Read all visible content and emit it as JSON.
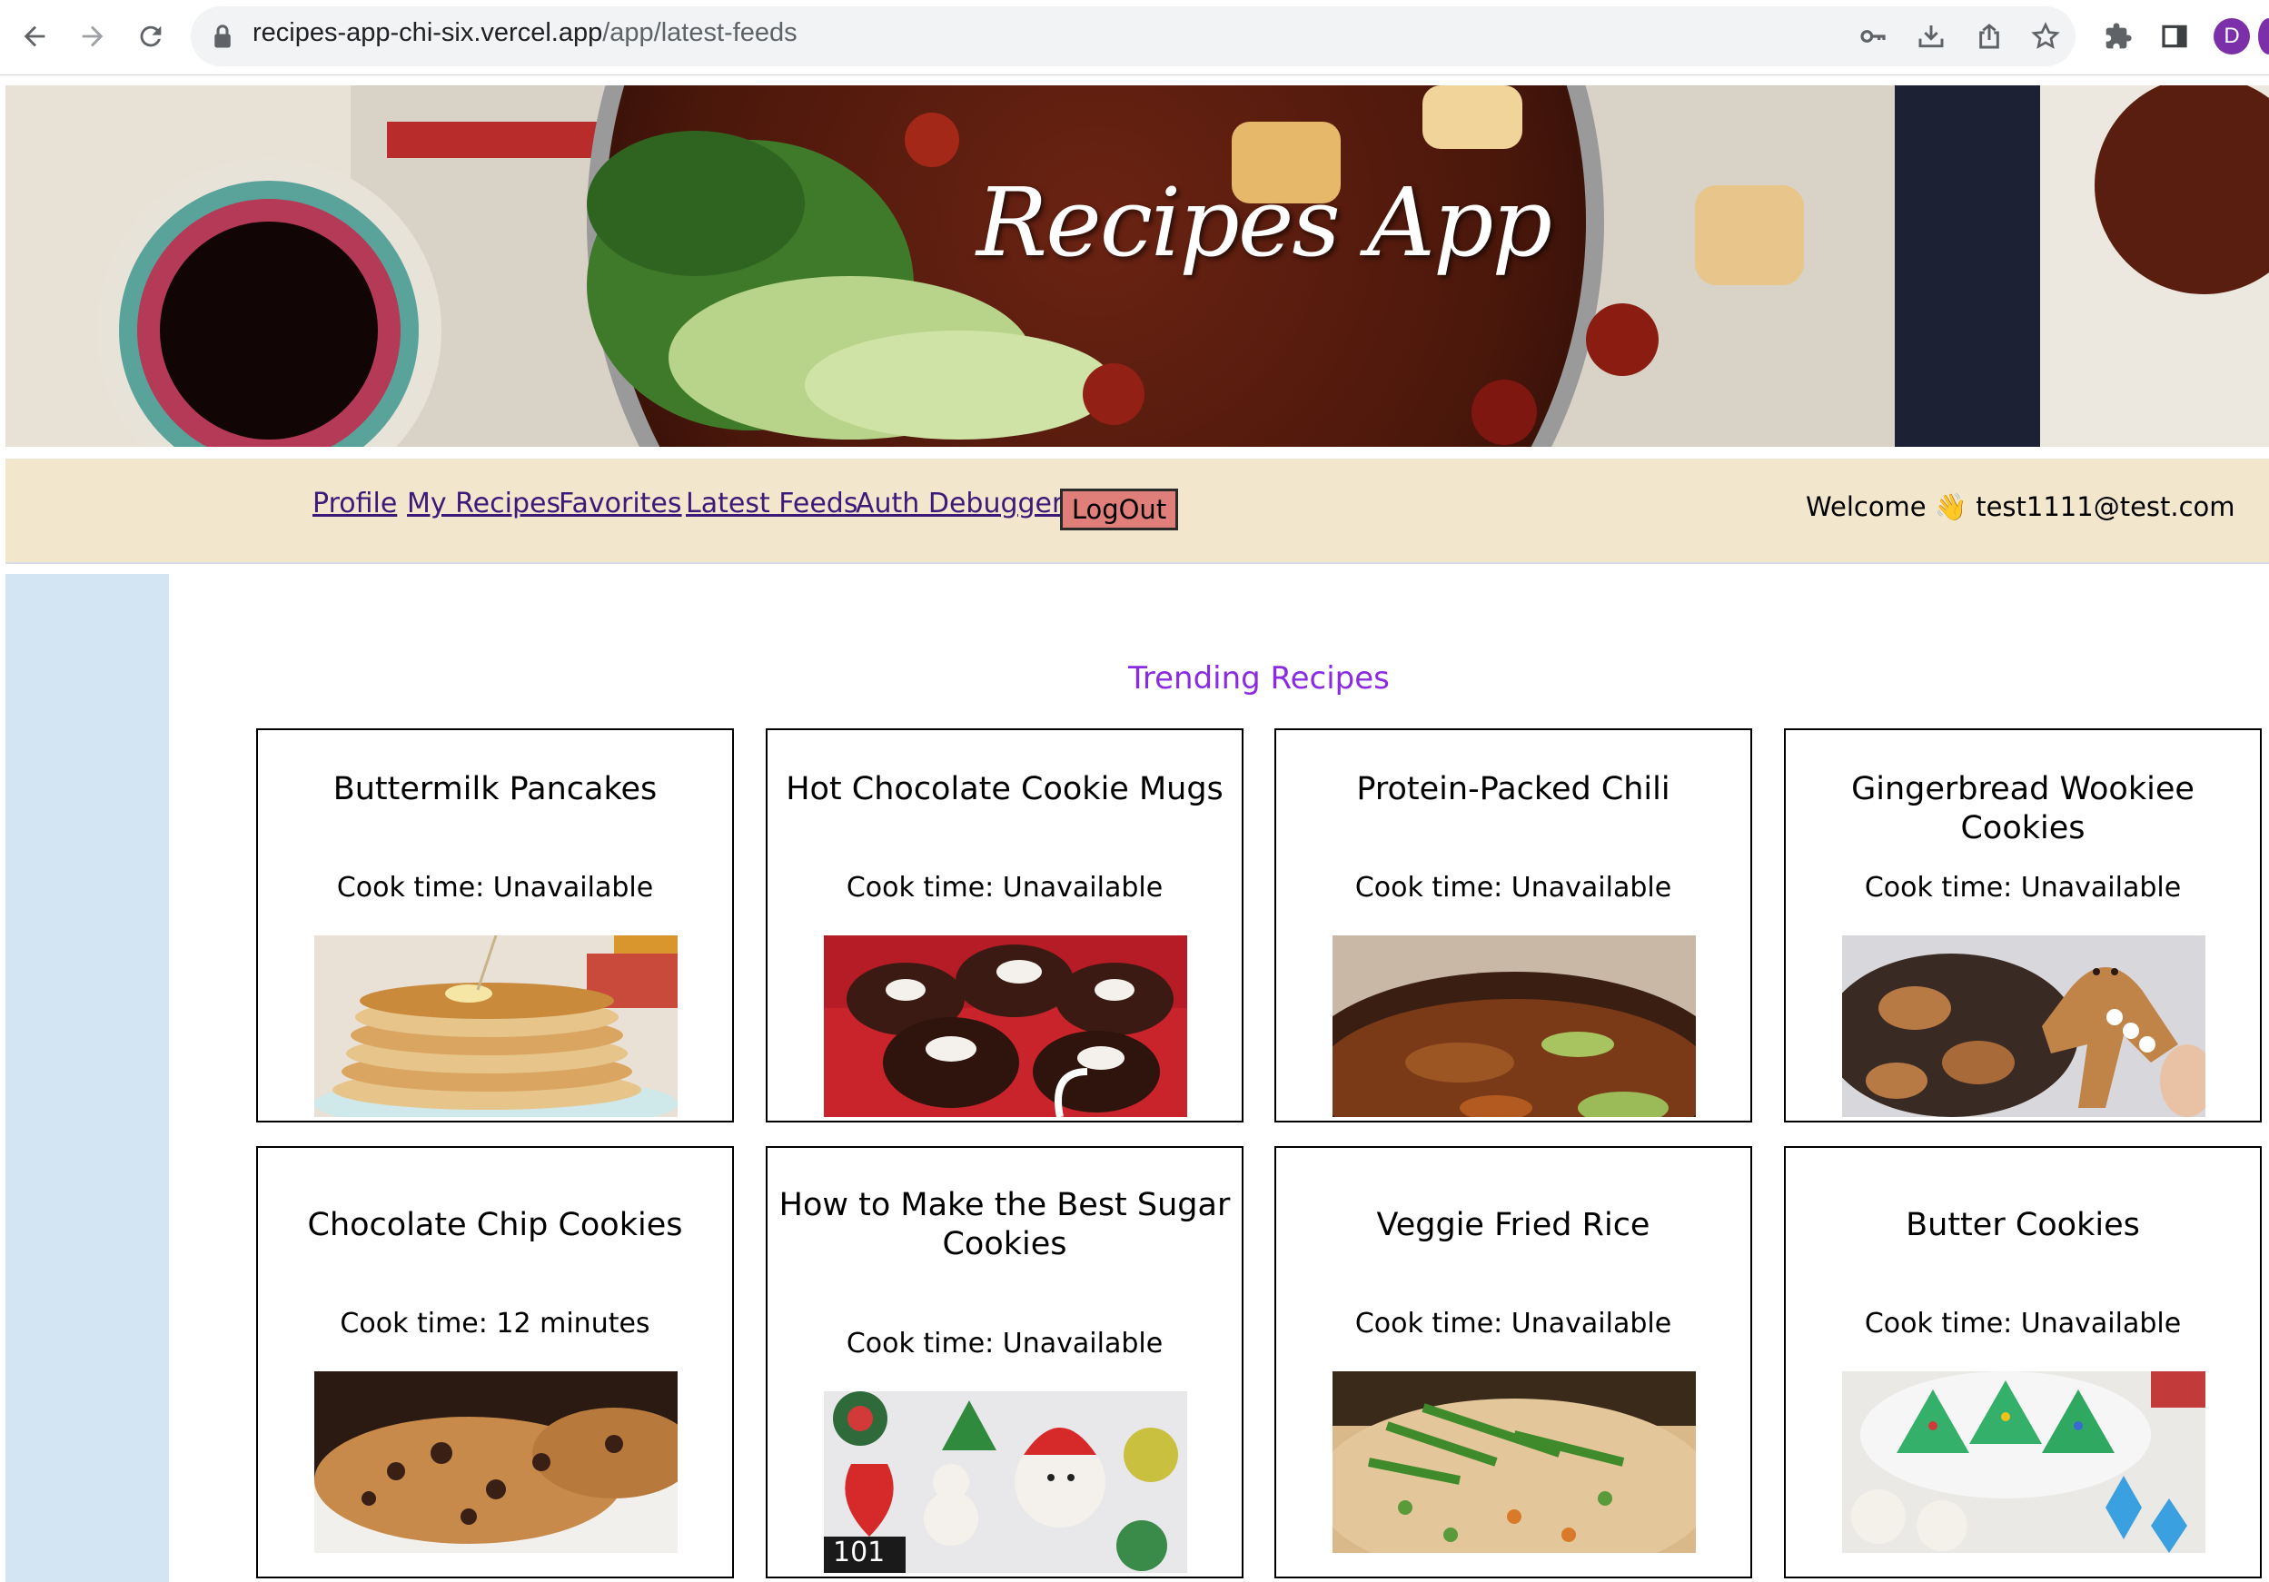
{
  "browser": {
    "url_domain": "recipes-app-chi-six.vercel.app",
    "url_path": "/app/latest-feeds",
    "profile_initial": "D"
  },
  "app": {
    "title": "Recipes App"
  },
  "nav": {
    "links": [
      "Profile",
      "My Recipes",
      "Favorites",
      "Latest Feeds",
      "Auth Debugger"
    ],
    "logout_label": "LogOut",
    "welcome": "Welcome 👋 test1111@test.com"
  },
  "section_title": "Trending Recipes",
  "recipes": [
    {
      "title": "Buttermilk Pancakes",
      "cook_time": "Cook time: Unavailable",
      "image": "pancakes"
    },
    {
      "title": "Hot Chocolate Cookie Mugs",
      "cook_time": "Cook time: Unavailable",
      "image": "cookie-mugs"
    },
    {
      "title": "Protein-Packed Chili",
      "cook_time": "Cook time: Unavailable",
      "image": "chili"
    },
    {
      "title": "Gingerbread Wookiee Cookies",
      "cook_time": "Cook time: Unavailable",
      "image": "gingerbread"
    },
    {
      "title": "Chocolate Chip Cookies",
      "cook_time": "Cook time: 12 minutes",
      "image": "chocolate-chip"
    },
    {
      "title": "How to Make the Best Sugar Cookies",
      "cook_time": "Cook time: Unavailable",
      "image": "sugar-cookies",
      "badge": "101"
    },
    {
      "title": "Veggie Fried Rice",
      "cook_time": "Cook time: Unavailable",
      "image": "fried-rice"
    },
    {
      "title": "Butter Cookies",
      "cook_time": "Cook time: Unavailable",
      "image": "butter-cookies"
    }
  ]
}
